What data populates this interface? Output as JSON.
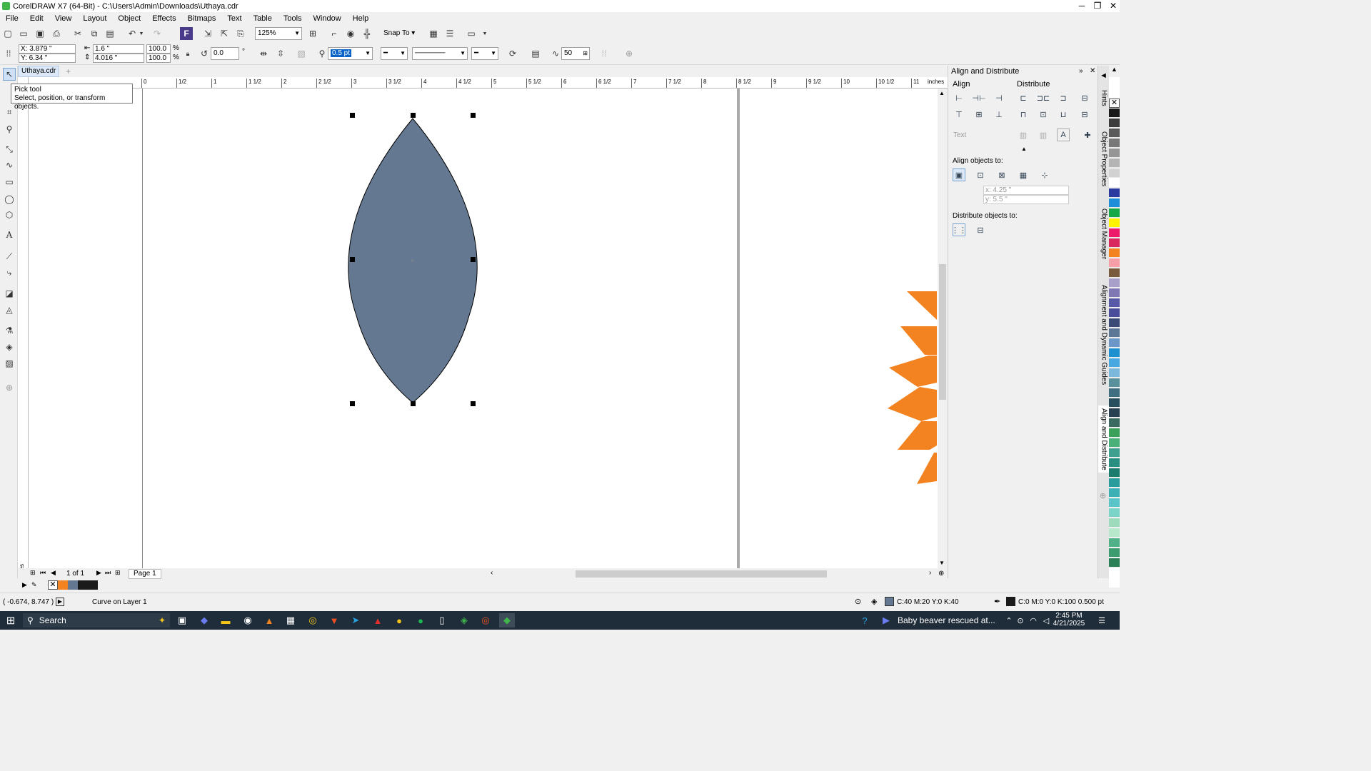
{
  "titlebar": {
    "title": "CorelDRAW X7 (64-Bit) - C:\\Users\\Admin\\Downloads\\Uthaya.cdr",
    "minimize": "─",
    "restore": "❐",
    "close": "✕"
  },
  "menu": [
    "File",
    "Edit",
    "View",
    "Layout",
    "Object",
    "Effects",
    "Bitmaps",
    "Text",
    "Table",
    "Tools",
    "Window",
    "Help"
  ],
  "standard_toolbar": {
    "zoom": "125%",
    "snap_to": "Snap To"
  },
  "property_bar": {
    "x": "X: 3.879 \"",
    "y": "Y: 6.34 \"",
    "w": "1.6 \"",
    "h": "4.016 \"",
    "scale_w": "100.0",
    "scale_h": "100.0",
    "pct1": "%",
    "pct2": "%",
    "rotation": "0.0",
    "deg": "°",
    "outline_width": "0.5 pt",
    "smoothing": "50"
  },
  "document_tab": "Uthaya.cdr",
  "tooltip": {
    "title": "Pick tool",
    "text": "Select, position, or transform objects."
  },
  "ruler_labels": [
    "0",
    "1/2",
    "1",
    "1 1/2",
    "2",
    "2 1/2",
    "3",
    "3 1/2",
    "4",
    "4 1/2",
    "5",
    "5 1/2",
    "6",
    "6 1/2",
    "7",
    "7 1/2",
    "8",
    "8 1/2",
    "9",
    "9 1/2",
    "10",
    "10 1/2",
    "11"
  ],
  "ruler_unit": "inches",
  "page_nav": {
    "pages": "1 of 1",
    "page_tab": "Page 1"
  },
  "docker": {
    "title": "Align and Distribute",
    "align": "Align",
    "distribute": "Distribute",
    "text": "Text",
    "align_objects_to": "Align objects to:",
    "x": "x: 4.25 \"",
    "y": "y: 5.5 \"",
    "distribute_objects_to": "Distribute objects to:"
  },
  "side_tabs": [
    "Hints",
    "Object Properties",
    "Object Manager",
    "Alignment and Dynamic Guides",
    "Align and Distribute"
  ],
  "status": {
    "coords": "( -0.674, 8.747 )",
    "object": "Curve on Layer 1",
    "fill": "C:40 M:20 Y:0 K:40",
    "outline": "C:0 M:0 Y:0 K:100  0.500 pt"
  },
  "taskbar": {
    "search": "Search",
    "news": "Baby beaver rescued at...",
    "time": "2:45 PM",
    "date": "4/21/2025"
  },
  "colors": {
    "shape_fill": "#647891",
    "orange": "#f38320",
    "palette": [
      "#1a1a1a",
      "#3d3d3d",
      "#5a5a5a",
      "#787878",
      "#969696",
      "#b4b4b4",
      "#d2d2d2",
      "#ffffff",
      "#2a3a9e",
      "#1e8ed8",
      "#18a848",
      "#fff200",
      "#ed1c6a",
      "#d8285e",
      "#f38320",
      "#f5a0a8",
      "#7a5a3c",
      "#a8a0c8",
      "#8078b4",
      "#5858a8",
      "#4a4e9a",
      "#3c4a78",
      "#5c7896",
      "#6a96c8",
      "#1e90d0",
      "#4aa8e0",
      "#7cb8dc",
      "#58909c",
      "#3e6e80",
      "#284f5e",
      "#284050",
      "#3a6a60",
      "#3aa05a",
      "#4ab07a",
      "#40a090",
      "#2a8e80",
      "#1c7c6e",
      "#2a9c9c",
      "#3cb0b4",
      "#5ac4c8",
      "#7cd4c8",
      "#9cdcbc",
      "#b8e8cc",
      "#50b088",
      "#3c9c70",
      "#2c8058"
    ]
  }
}
